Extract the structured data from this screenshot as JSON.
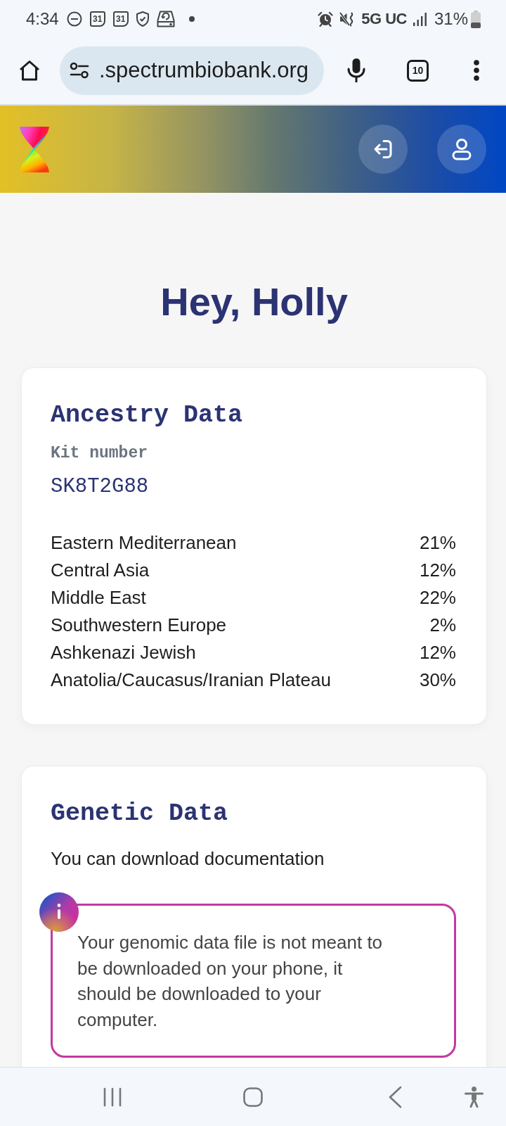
{
  "status_bar": {
    "time": "4:34",
    "calendar_dates": [
      "31",
      "31"
    ],
    "network": "5G UC",
    "battery": "31%"
  },
  "browser": {
    "url": ".spectrumbiobank.org",
    "tab_count": "10"
  },
  "header": {
    "buttons": [
      {
        "kind": "sign_in"
      },
      {
        "kind": "profile"
      }
    ]
  },
  "greeting": "Hey, Holly",
  "ancestry": {
    "title": "Ancestry Data",
    "kit_label": "Kit number",
    "kit_number": "SK8T2G88",
    "regions": [
      {
        "name": "Eastern Mediterranean",
        "percent": "21%"
      },
      {
        "name": "Central Asia",
        "percent": "12%"
      },
      {
        "name": "Middle East",
        "percent": "22%"
      },
      {
        "name": "Southwestern Europe",
        "percent": "2%"
      },
      {
        "name": "Ashkenazi Jewish",
        "percent": "12%"
      },
      {
        "name": "Anatolia/Caucasus/Iranian Plateau",
        "percent": "30%"
      }
    ]
  },
  "genetic": {
    "title": "Genetic Data",
    "text": "You can download documentation",
    "notice": "Your genomic data file is not meant to be downloaded on your phone, it should be downloaded to your computer."
  }
}
